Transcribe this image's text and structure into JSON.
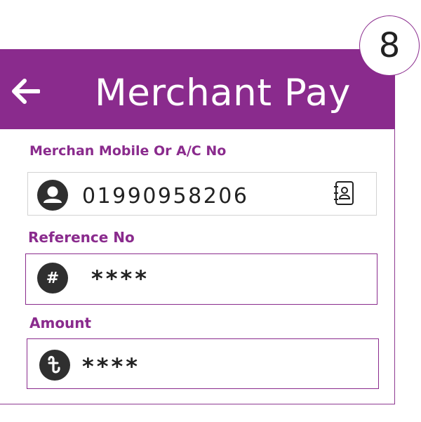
{
  "header": {
    "title": "Merchant Pay",
    "back_icon": "arrow-left-icon"
  },
  "step_badge": "8",
  "form": {
    "merchant": {
      "label": "Merchan Mobile Or A/C No",
      "value": "01990958206",
      "icon": "user-icon",
      "action_icon": "contact-book-icon"
    },
    "reference": {
      "label": "Reference No",
      "value": "****",
      "icon": "hash-icon",
      "icon_glyph": "#"
    },
    "amount": {
      "label": "Amount",
      "value": "****",
      "icon": "taka-icon"
    }
  },
  "colors": {
    "brand": "#8a2b8d",
    "icon_bg": "#2f2f2f",
    "text": "#222222",
    "field_border": "#d3d3d3"
  }
}
